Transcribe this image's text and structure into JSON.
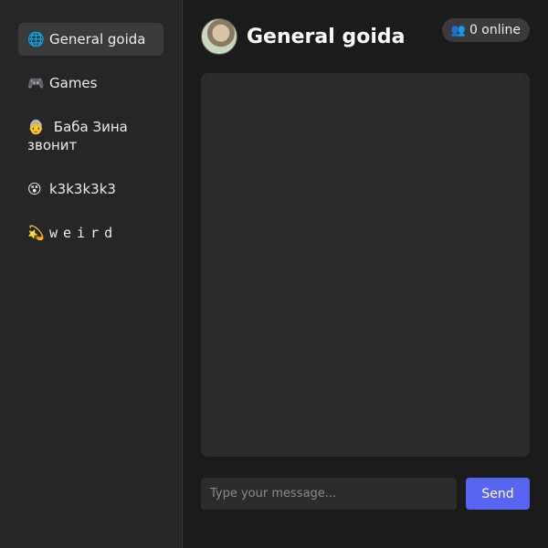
{
  "sidebar": {
    "rooms": [
      {
        "emoji": "🌐",
        "label": "General goida",
        "active": true
      },
      {
        "emoji": "🎮",
        "label": "Games"
      },
      {
        "emoji": "👵",
        "label": "Баба Зина звонит"
      },
      {
        "emoji": "😵",
        "label": "k3k3k3k3"
      },
      {
        "emoji": "💫",
        "label": "weird"
      }
    ]
  },
  "header": {
    "title": "General goida",
    "online_icon": "👥",
    "online_label": "0 online"
  },
  "composer": {
    "placeholder": "Type your message...",
    "send_label": "Send"
  },
  "colors": {
    "accent": "#5865f2",
    "background": "#1b1b1b",
    "sidebar": "#262626",
    "panel": "#2c2c2c"
  }
}
